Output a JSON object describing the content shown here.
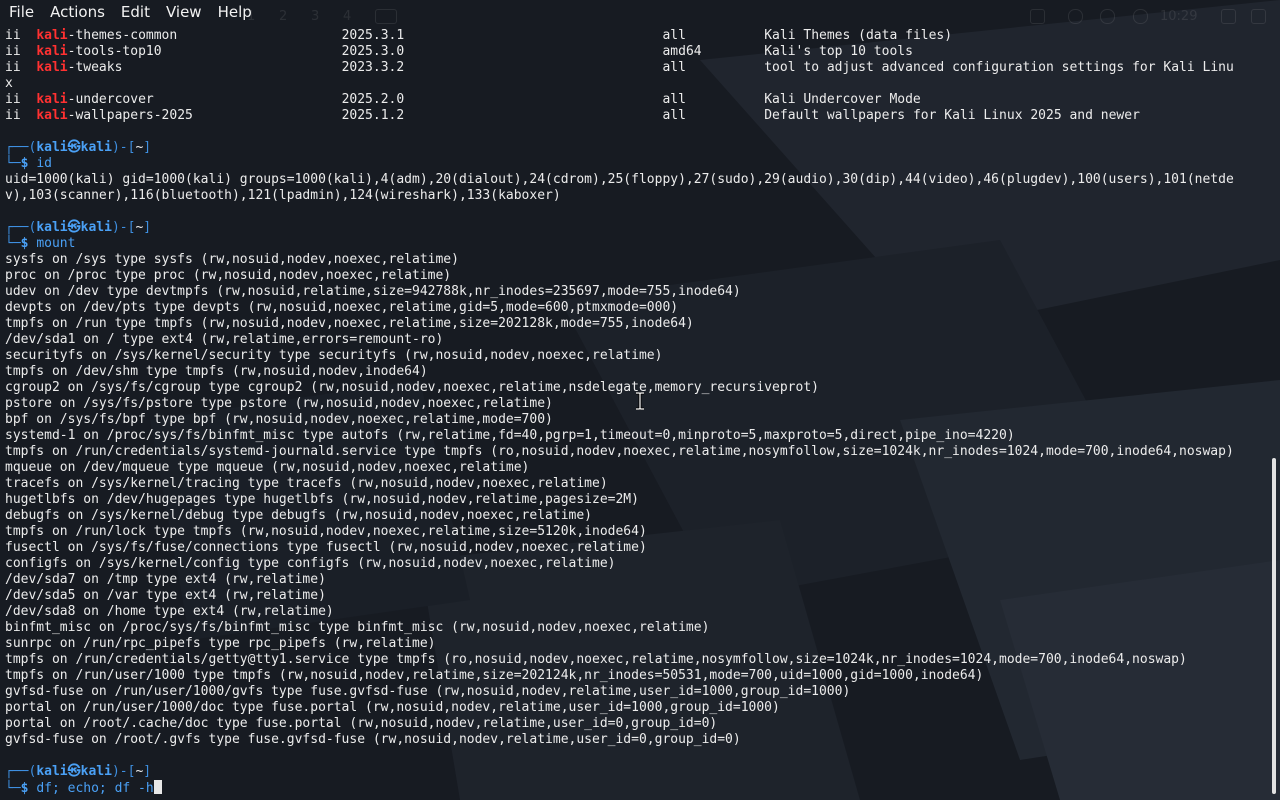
{
  "menu": [
    "File",
    "Actions",
    "Edit",
    "View",
    "Help"
  ],
  "background_panel": {
    "workspaces": [
      "1",
      "2",
      "3",
      "4"
    ],
    "clock": "10:29"
  },
  "prompt": {
    "user": "kali",
    "at_symbol": "㉿",
    "host": "kali",
    "path": "~",
    "symbol": "$"
  },
  "packages": [
    {
      "status": "ii",
      "name_prefix": "kali",
      "name_rest": "-themes-common",
      "version": "2025.3.1",
      "arch": "all",
      "description": "Kali Themes (data files)"
    },
    {
      "status": "ii",
      "name_prefix": "kali",
      "name_rest": "-tools-top10",
      "version": "2025.3.0",
      "arch": "amd64",
      "description": "Kali's top 10 tools"
    },
    {
      "status": "ii",
      "name_prefix": "kali",
      "name_rest": "-tweaks",
      "version": "2023.3.2",
      "arch": "all",
      "description": "tool to adjust advanced configuration settings for Kali Linu"
    },
    {
      "status": "ii",
      "name_prefix": "kali",
      "name_rest": "-undercover",
      "version": "2025.2.0",
      "arch": "all",
      "description": "Kali Undercover Mode"
    },
    {
      "status": "ii",
      "name_prefix": "kali",
      "name_rest": "-wallpapers-2025",
      "version": "2025.1.2",
      "arch": "all",
      "description": "Default wallpapers for Kali Linux 2025 and newer"
    }
  ],
  "wrap_tail": "x",
  "commands": {
    "id": "id",
    "mount": "mount",
    "current": "df; echo; df -h"
  },
  "id_output": [
    "uid=1000(kali) gid=1000(kali) groups=1000(kali),4(adm),20(dialout),24(cdrom),25(floppy),27(sudo),29(audio),30(dip),44(video),46(plugdev),100(users),101(netde",
    "v),103(scanner),116(bluetooth),121(lpadmin),124(wireshark),133(kaboxer)"
  ],
  "mount_output": [
    "sysfs on /sys type sysfs (rw,nosuid,nodev,noexec,relatime)",
    "proc on /proc type proc (rw,nosuid,nodev,noexec,relatime)",
    "udev on /dev type devtmpfs (rw,nosuid,relatime,size=942788k,nr_inodes=235697,mode=755,inode64)",
    "devpts on /dev/pts type devpts (rw,nosuid,noexec,relatime,gid=5,mode=600,ptmxmode=000)",
    "tmpfs on /run type tmpfs (rw,nosuid,nodev,noexec,relatime,size=202128k,mode=755,inode64)",
    "/dev/sda1 on / type ext4 (rw,relatime,errors=remount-ro)",
    "securityfs on /sys/kernel/security type securityfs (rw,nosuid,nodev,noexec,relatime)",
    "tmpfs on /dev/shm type tmpfs (rw,nosuid,nodev,inode64)",
    "cgroup2 on /sys/fs/cgroup type cgroup2 (rw,nosuid,nodev,noexec,relatime,nsdelegate,memory_recursiveprot)",
    "pstore on /sys/fs/pstore type pstore (rw,nosuid,nodev,noexec,relatime)",
    "bpf on /sys/fs/bpf type bpf (rw,nosuid,nodev,noexec,relatime,mode=700)",
    "systemd-1 on /proc/sys/fs/binfmt_misc type autofs (rw,relatime,fd=40,pgrp=1,timeout=0,minproto=5,maxproto=5,direct,pipe_ino=4220)",
    "tmpfs on /run/credentials/systemd-journald.service type tmpfs (ro,nosuid,nodev,noexec,relatime,nosymfollow,size=1024k,nr_inodes=1024,mode=700,inode64,noswap)",
    "mqueue on /dev/mqueue type mqueue (rw,nosuid,nodev,noexec,relatime)",
    "tracefs on /sys/kernel/tracing type tracefs (rw,nosuid,nodev,noexec,relatime)",
    "hugetlbfs on /dev/hugepages type hugetlbfs (rw,nosuid,nodev,relatime,pagesize=2M)",
    "debugfs on /sys/kernel/debug type debugfs (rw,nosuid,nodev,noexec,relatime)",
    "tmpfs on /run/lock type tmpfs (rw,nosuid,nodev,noexec,relatime,size=5120k,inode64)",
    "fusectl on /sys/fs/fuse/connections type fusectl (rw,nosuid,nodev,noexec,relatime)",
    "configfs on /sys/kernel/config type configfs (rw,nosuid,nodev,noexec,relatime)",
    "/dev/sda7 on /tmp type ext4 (rw,relatime)",
    "/dev/sda5 on /var type ext4 (rw,relatime)",
    "/dev/sda8 on /home type ext4 (rw,relatime)",
    "binfmt_misc on /proc/sys/fs/binfmt_misc type binfmt_misc (rw,nosuid,nodev,noexec,relatime)",
    "sunrpc on /run/rpc_pipefs type rpc_pipefs (rw,relatime)",
    "tmpfs on /run/credentials/getty@tty1.service type tmpfs (ro,nosuid,nodev,noexec,relatime,nosymfollow,size=1024k,nr_inodes=1024,mode=700,inode64,noswap)",
    "tmpfs on /run/user/1000 type tmpfs (rw,nosuid,nodev,relatime,size=202124k,nr_inodes=50531,mode=700,uid=1000,gid=1000,inode64)",
    "gvfsd-fuse on /run/user/1000/gvfs type fuse.gvfsd-fuse (rw,nosuid,nodev,relatime,user_id=1000,group_id=1000)",
    "portal on /run/user/1000/doc type fuse.portal (rw,nosuid,nodev,relatime,user_id=1000,group_id=1000)",
    "portal on /root/.cache/doc type fuse.portal (rw,nosuid,nodev,relatime,user_id=0,group_id=0)",
    "gvfsd-fuse on /root/.gvfs type fuse.gvfsd-fuse (rw,nosuid,nodev,relatime,user_id=0,group_id=0)"
  ],
  "colors": {
    "background": "#171b22",
    "text": "#ececec",
    "prompt_blue": "#4aa0f5",
    "prompt_box": "#3e8fe0",
    "highlight_red": "#ff3131",
    "scrollbar": "#e2e2e2"
  },
  "icons": [
    "text-cursor-icon",
    "terminal-block-cursor"
  ]
}
